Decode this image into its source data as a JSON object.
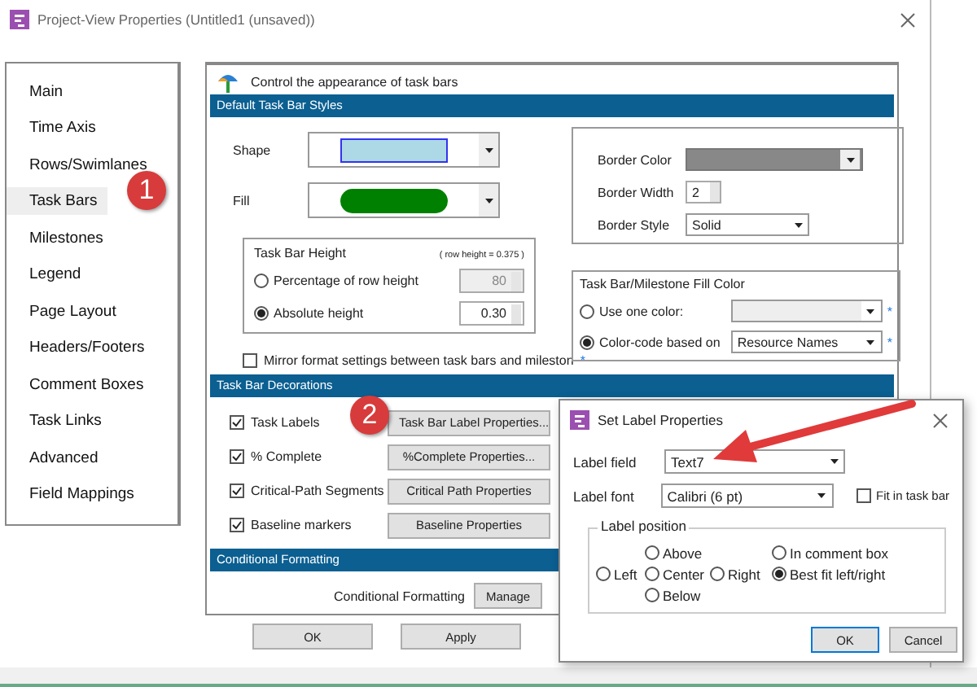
{
  "window": {
    "title": "Project-View Properties (Untitled1 (unsaved))"
  },
  "sidebar": {
    "items": [
      {
        "label": "Main",
        "selected": false
      },
      {
        "label": "Time Axis",
        "selected": false
      },
      {
        "label": "Rows/Swimlanes",
        "selected": false
      },
      {
        "label": "Task Bars",
        "selected": true
      },
      {
        "label": "Milestones",
        "selected": false
      },
      {
        "label": "Legend",
        "selected": false
      },
      {
        "label": "Page Layout",
        "selected": false
      },
      {
        "label": "Headers/Footers",
        "selected": false
      },
      {
        "label": "Comment Boxes",
        "selected": false
      },
      {
        "label": "Task Links",
        "selected": false
      },
      {
        "label": "Advanced",
        "selected": false
      },
      {
        "label": "Field Mappings",
        "selected": false
      }
    ]
  },
  "panel": {
    "header": "Control the appearance of task bars"
  },
  "default_styles": {
    "title": "Default Task Bar Styles",
    "shape": {
      "label": "Shape"
    },
    "fill": {
      "label": "Fill"
    },
    "height_group": {
      "title": "Task Bar Height",
      "note": "( row height =  0.375 )",
      "options": [
        {
          "label": "Percentage of row height",
          "selected": false,
          "value": "80"
        },
        {
          "label": "Absolute height",
          "selected": true,
          "value": "0.30"
        }
      ]
    },
    "mirror": {
      "label": "Mirror format settings between task bars and mileston",
      "checked": false,
      "hint": "*"
    },
    "border": {
      "color_label": "Border Color",
      "width_label": "Border Width",
      "width_value": "2",
      "style_label": "Border Style",
      "style_value": "Solid"
    },
    "fill_color": {
      "title": "Task Bar/Milestone Fill Color",
      "options": [
        {
          "label": "Use one color:",
          "selected": false,
          "hint": "*"
        },
        {
          "label": "Color-code based on",
          "selected": true,
          "value": "Resource Names",
          "hint": "*"
        }
      ]
    }
  },
  "decorations": {
    "title": "Task Bar Decorations",
    "items": [
      {
        "label": "Task Labels",
        "checked": true,
        "button": "Task Bar Label Properties..."
      },
      {
        "label": "% Complete",
        "checked": true,
        "button": "%Complete Properties..."
      },
      {
        "label": "Critical-Path Segments",
        "checked": true,
        "button": "Critical Path Properties"
      },
      {
        "label": "Baseline markers",
        "checked": true,
        "button": "Baseline Properties"
      }
    ]
  },
  "conditional": {
    "title": "Conditional Formatting",
    "label": "Conditional Formatting",
    "button": "Manage"
  },
  "buttons": [
    "OK",
    "Apply"
  ],
  "dialog": {
    "title": "Set Label Properties",
    "label_field": {
      "label": "Label field",
      "value": "Text7"
    },
    "label_font": {
      "label": "Label font",
      "value": "Calibri (6 pt)"
    },
    "fit": {
      "label": "Fit in task bar",
      "checked": false
    },
    "position": {
      "title": "Label position",
      "options": [
        {
          "label": "Left",
          "selected": false
        },
        {
          "label": "Above",
          "selected": false
        },
        {
          "label": "Center",
          "selected": false
        },
        {
          "label": "Below",
          "selected": false
        },
        {
          "label": "Right",
          "selected": false
        },
        {
          "label": "In comment box",
          "selected": false
        },
        {
          "label": "Best fit left/right",
          "selected": true
        }
      ]
    },
    "buttons": [
      {
        "label": "OK",
        "default": true
      },
      {
        "label": "Cancel",
        "default": false
      }
    ]
  },
  "callouts": [
    {
      "label": "1"
    },
    {
      "label": "2"
    }
  ]
}
